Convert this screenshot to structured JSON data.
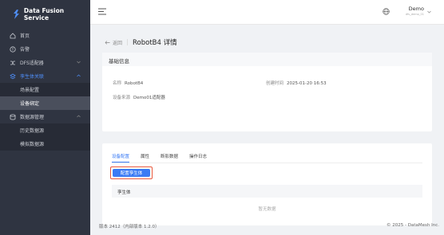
{
  "app": {
    "name": "Data Fusion Service"
  },
  "sidebar": {
    "items": [
      {
        "label": "首页",
        "icon": "home-icon"
      },
      {
        "label": "告警",
        "icon": "alert-icon"
      },
      {
        "label": "DFS适配器",
        "icon": "shuffle-icon"
      },
      {
        "label": "孪生体关联",
        "icon": "layers-icon"
      },
      {
        "label": "数据源管理",
        "icon": "database-icon"
      }
    ],
    "sub_twin": [
      {
        "label": "场景配置"
      },
      {
        "label": "设备绑定"
      }
    ],
    "sub_ds": [
      {
        "label": "历史数据源"
      },
      {
        "label": "模拟数据源"
      }
    ]
  },
  "header": {
    "user_name": "Demo",
    "user_sub": "dfs_demo_01"
  },
  "page": {
    "back_label": "返回",
    "title": "RobotB4 详情"
  },
  "basic": {
    "heading": "基础信息",
    "name_label": "名称",
    "name_value": "RobotB4",
    "created_label": "创建时间",
    "created_value": "2025-01-20 16:53",
    "source_label": "设备来源",
    "source_value": "Demo01适配器"
  },
  "tabs": [
    {
      "label": "设备配置"
    },
    {
      "label": "属性"
    },
    {
      "label": "断影数据"
    },
    {
      "label": "操作日志"
    }
  ],
  "config": {
    "button_label": "配置孪生体",
    "column_header": "孪生体",
    "empty_text": "暂无数据"
  },
  "footer": {
    "version": "版本 2412（内部版本 1.2.0）",
    "copyright": "© 2025 - DataMesh Inc."
  },
  "colors": {
    "sidebar_bg": "#2f3441",
    "accent": "#3a7bf5",
    "highlight_border": "#e8583c"
  }
}
